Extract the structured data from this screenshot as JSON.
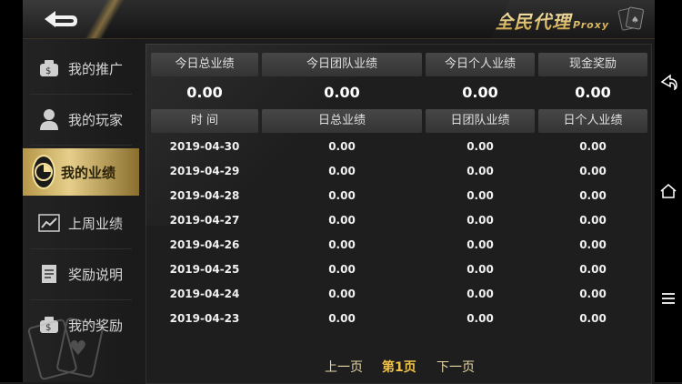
{
  "brand": {
    "title": "全民代理",
    "subtitle": "Proxy"
  },
  "sidebar": {
    "items": [
      {
        "label": "我的推广",
        "icon": "money-bag-icon",
        "active": false
      },
      {
        "label": "我的玩家",
        "icon": "person-icon",
        "active": false
      },
      {
        "label": "我的业绩",
        "icon": "pie-chart-icon",
        "active": true
      },
      {
        "label": "上周业绩",
        "icon": "line-chart-icon",
        "active": false
      },
      {
        "label": "奖励说明",
        "icon": "document-icon",
        "active": false
      },
      {
        "label": "我的奖励",
        "icon": "money-bag-icon",
        "active": false
      }
    ]
  },
  "summary": {
    "headers": [
      "今日总业绩",
      "今日团队业绩",
      "今日个人业绩",
      "现金奖励"
    ],
    "values": [
      "0.00",
      "0.00",
      "0.00",
      "0.00"
    ]
  },
  "table": {
    "columns": [
      "时 间",
      "日总业绩",
      "日团队业绩",
      "日个人业绩"
    ],
    "rows": [
      [
        "2019-04-30",
        "0.00",
        "0.00",
        "0.00"
      ],
      [
        "2019-04-29",
        "0.00",
        "0.00",
        "0.00"
      ],
      [
        "2019-04-28",
        "0.00",
        "0.00",
        "0.00"
      ],
      [
        "2019-04-27",
        "0.00",
        "0.00",
        "0.00"
      ],
      [
        "2019-04-26",
        "0.00",
        "0.00",
        "0.00"
      ],
      [
        "2019-04-25",
        "0.00",
        "0.00",
        "0.00"
      ],
      [
        "2019-04-24",
        "0.00",
        "0.00",
        "0.00"
      ],
      [
        "2019-04-23",
        "0.00",
        "0.00",
        "0.00"
      ]
    ]
  },
  "pagination": {
    "prev": "上一页",
    "current": "第1页",
    "next": "下一页"
  },
  "colors": {
    "accent_gold": "#d9bf74",
    "current_page": "#f0c24a",
    "background": "#1b1b1b"
  }
}
